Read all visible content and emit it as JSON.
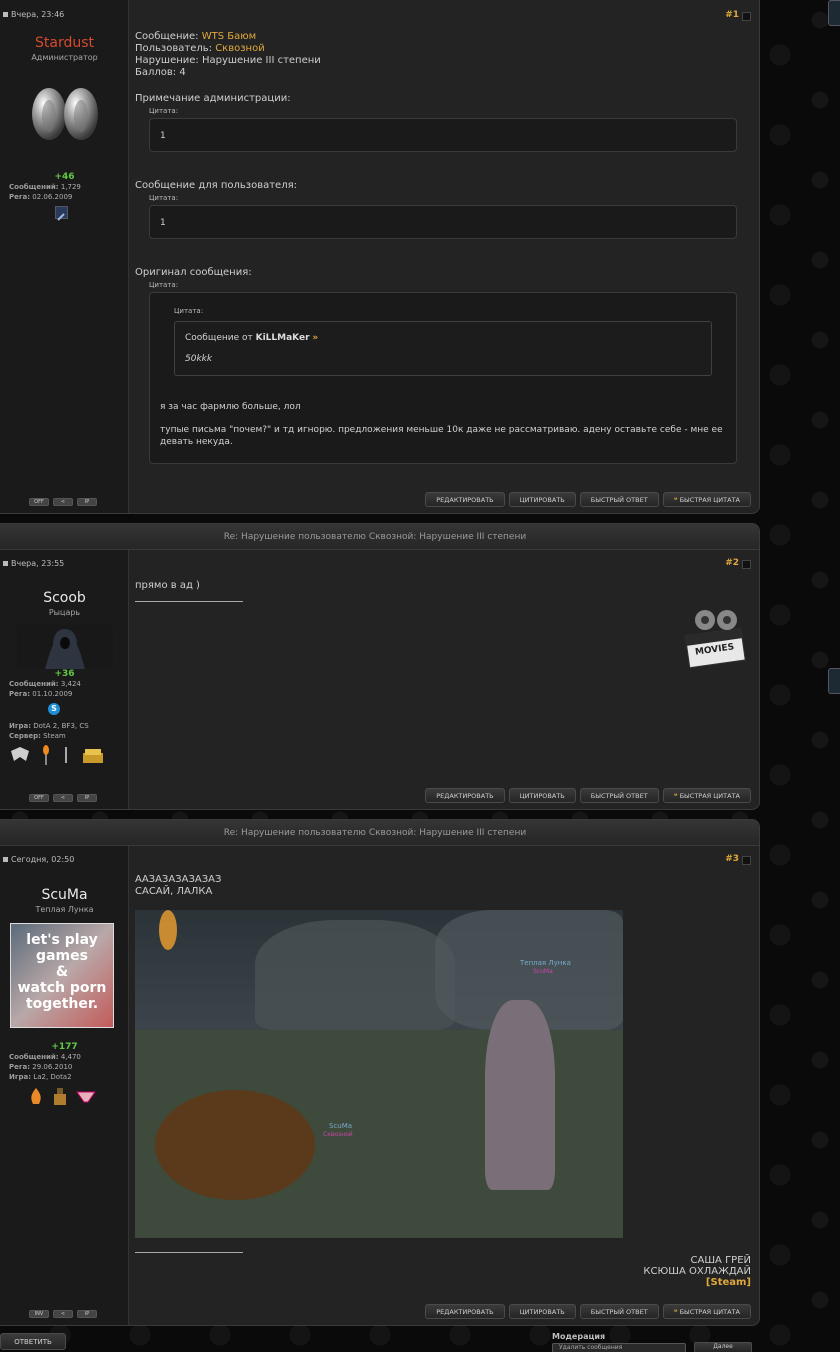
{
  "posts": [
    {
      "number": "#1",
      "date": "Вчера, 23:46",
      "user": {
        "name": "Stardust",
        "name_color": "#d64a2e",
        "title": "Администратор",
        "rep": "+46",
        "stats": [
          {
            "k": "Сообщений:",
            "v": "1,729"
          },
          {
            "k": "Рега:",
            "v": "02.06.2009"
          }
        ]
      },
      "mini": [
        "OFF",
        "<",
        "IP"
      ],
      "header_title": "",
      "lines": [
        {
          "label": "Сообщение:",
          "value": "WTS Баюм"
        },
        {
          "label": "Пользователь:",
          "value": "Сквозной"
        },
        {
          "label": "Нарушение:",
          "value": "Нарушение III степени"
        },
        {
          "label": "Баллов:",
          "value": "4"
        }
      ],
      "admin_note_label": "Примечание администрации:",
      "quote_label": "Цитата:",
      "admin_note": "1",
      "user_msg_label": "Сообщение для пользователя:",
      "user_msg": "1",
      "orig_label": "Оригинал сообщения:",
      "inner_quote_prefix": "Сообщение от",
      "inner_quote_author": "KiLLMaKer",
      "inner_quote_arrow": "»",
      "inner_quote_text": "50kkk",
      "orig_text_1": "я за час фармлю больше, лол",
      "orig_text_2": "тупые письма \"почем?\" и тд игнорю. предложения меньше 10к даже не рассматриваю. адену оставьте себе - мне ее девать некуда."
    },
    {
      "number": "#2",
      "date": "Вчера, 23:55",
      "header_title": "Re: Нарушение пользователю Сквозной: Нарушение III степени",
      "user": {
        "name": "Scoob",
        "name_color": "#e8e8e8",
        "title": "Рыцарь",
        "rep": "+36",
        "stats": [
          {
            "k": "Сообщений:",
            "v": "3,424"
          },
          {
            "k": "Рега:",
            "v": "01.10.2009"
          }
        ],
        "extra": [
          {
            "k": "Игра:",
            "v": "DotA 2, BF3, CS"
          },
          {
            "k": "Сервер:",
            "v": "Steam"
          }
        ]
      },
      "mini": [
        "OFF",
        "<",
        "IP"
      ],
      "text": "прямо в ад )",
      "sig_badge": "MOVIES"
    },
    {
      "number": "#3",
      "date": "Сегодня, 02:50",
      "header_title": "Re: Нарушение пользователю Сквозной: Нарушение III степени",
      "user": {
        "name": "ScuMa",
        "name_color": "#e8e8e8",
        "title": "Теплая Лунка",
        "rep": "+177",
        "avatar_text": [
          "let's play",
          "games",
          "&",
          "watch porn",
          "together."
        ],
        "stats": [
          {
            "k": "Сообщений:",
            "v": "4,470"
          },
          {
            "k": "Рега:",
            "v": "29.06.2010"
          },
          {
            "k": "Игра:",
            "v": "La2, Dota2"
          }
        ]
      },
      "mini": [
        "INV",
        "<",
        "IP"
      ],
      "text_1": "ААЗАЗАЗАЗАЗАЗ",
      "text_2": "САСАЙ, ЛАЛКА",
      "game_labels": {
        "npc1": "Теплая Лунка",
        "npc1_sub": "ScuMa",
        "npc2": "ScuMa",
        "npc2_sub": "Сквозной"
      },
      "sig_1": "САША ГРЕЙ",
      "sig_2": "КСЮША ОХЛАЖДАЙ",
      "sig_3": "[Steam]"
    }
  ],
  "actions": {
    "edit": "РЕДАКТИРОВАТЬ",
    "quote": "ЦИТИРОВАТЬ",
    "quick_reply": "БЫСТРЫЙ ОТВЕТ",
    "quick_quote_mark": "❝",
    "quick_quote": "БЫСТРАЯ ЦИТАТА"
  },
  "footer": {
    "reply": "ОТВЕТИТЬ",
    "moderation": "Модерация",
    "mod_select": "Удалить сообщения",
    "mod_go": "Далее"
  }
}
